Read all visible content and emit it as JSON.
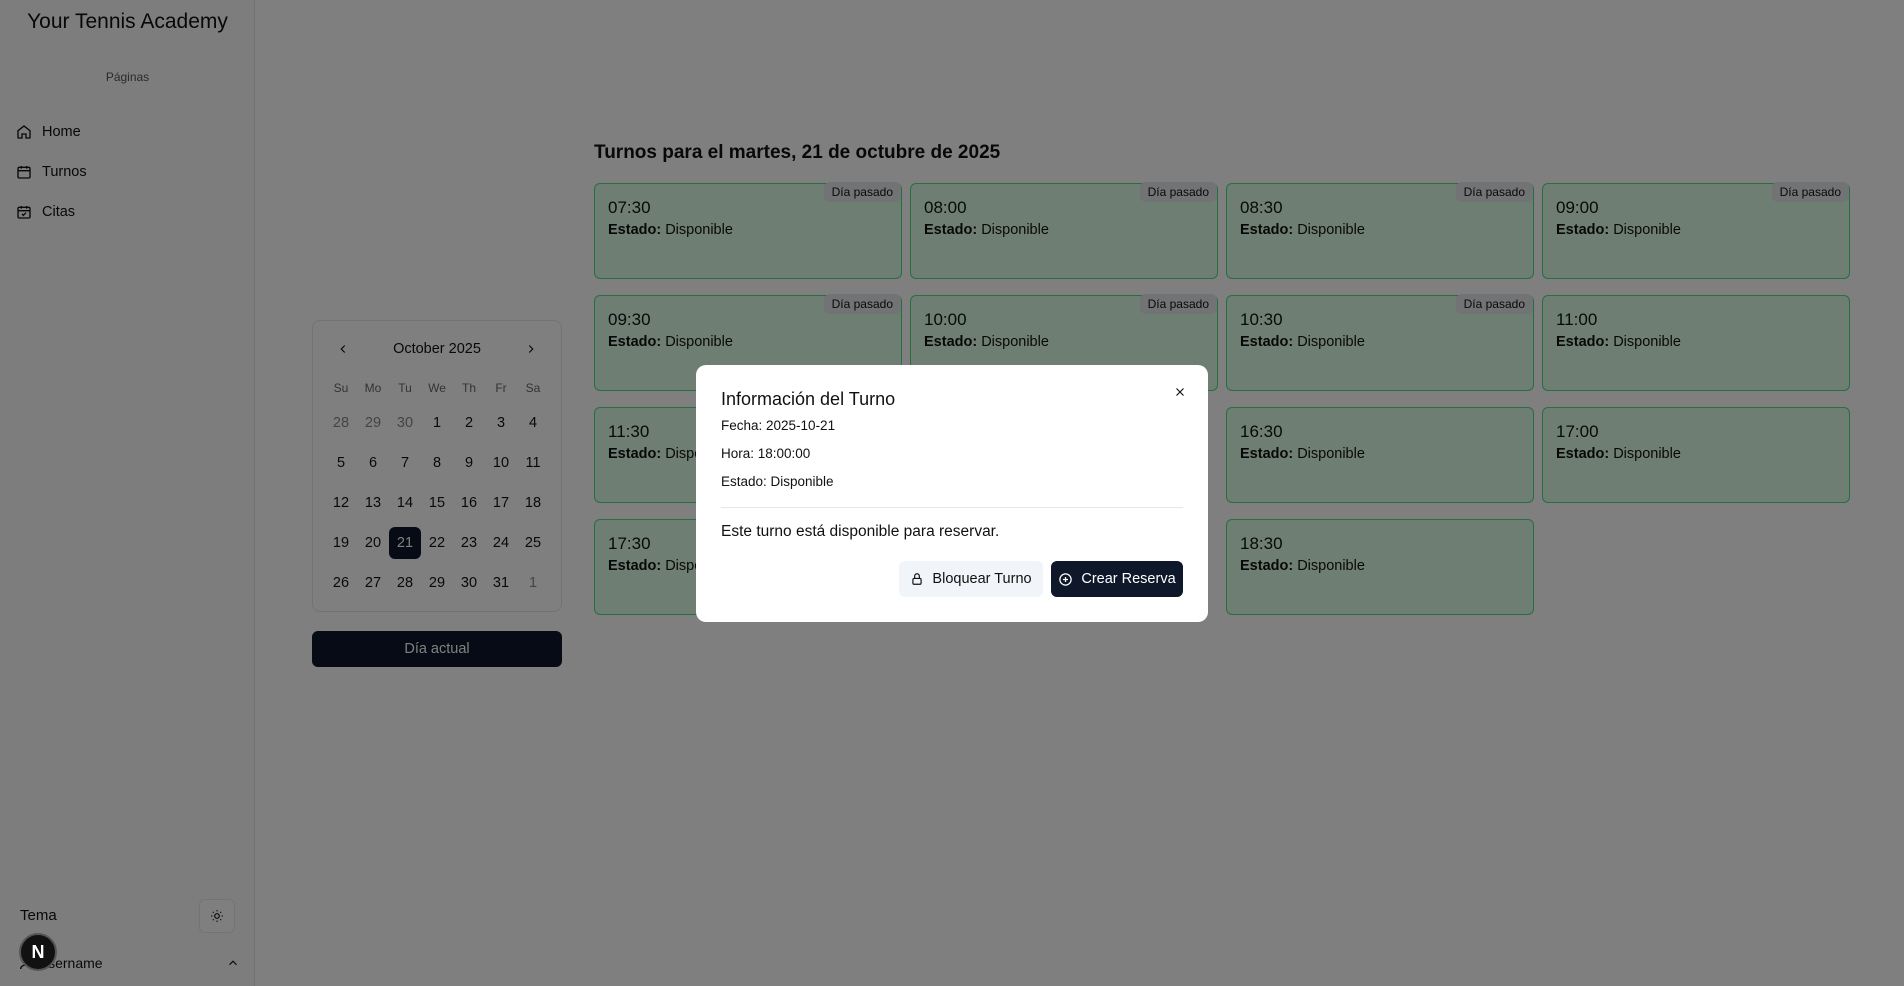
{
  "sidebar": {
    "brand": "Your Tennis Academy",
    "section_label": "Páginas",
    "items": [
      {
        "label": "Home",
        "icon": "home-icon"
      },
      {
        "label": "Turnos",
        "icon": "calendar-icon"
      },
      {
        "label": "Citas",
        "icon": "calendar-check-icon"
      }
    ],
    "theme_label": "Tema",
    "theme_icon": "sun-icon",
    "user_label": "Username",
    "avatar_letter": "N"
  },
  "calendar": {
    "month_title": "October 2025",
    "weekdays": [
      "Su",
      "Mo",
      "Tu",
      "We",
      "Th",
      "Fr",
      "Sa"
    ],
    "weeks": [
      [
        {
          "d": "28",
          "out": true
        },
        {
          "d": "29",
          "out": true
        },
        {
          "d": "30",
          "out": true
        },
        {
          "d": "1"
        },
        {
          "d": "2"
        },
        {
          "d": "3"
        },
        {
          "d": "4"
        }
      ],
      [
        {
          "d": "5"
        },
        {
          "d": "6"
        },
        {
          "d": "7"
        },
        {
          "d": "8"
        },
        {
          "d": "9"
        },
        {
          "d": "10"
        },
        {
          "d": "11"
        }
      ],
      [
        {
          "d": "12"
        },
        {
          "d": "13"
        },
        {
          "d": "14"
        },
        {
          "d": "15"
        },
        {
          "d": "16"
        },
        {
          "d": "17"
        },
        {
          "d": "18"
        }
      ],
      [
        {
          "d": "19"
        },
        {
          "d": "20"
        },
        {
          "d": "21",
          "sel": true
        },
        {
          "d": "22"
        },
        {
          "d": "23"
        },
        {
          "d": "24"
        },
        {
          "d": "25"
        }
      ],
      [
        {
          "d": "26"
        },
        {
          "d": "27"
        },
        {
          "d": "28"
        },
        {
          "d": "29"
        },
        {
          "d": "30"
        },
        {
          "d": "31"
        },
        {
          "d": "1",
          "out": true
        }
      ]
    ],
    "today_button": "Día actual"
  },
  "slots": {
    "title": "Turnos para el martes, 21 de octubre de 2025",
    "status_label": "Estado:",
    "items": [
      {
        "time": "07:30",
        "status": "Disponible",
        "badge": "Día pasado"
      },
      {
        "time": "08:00",
        "status": "Disponible",
        "badge": "Día pasado"
      },
      {
        "time": "08:30",
        "status": "Disponible",
        "badge": "Día pasado"
      },
      {
        "time": "09:00",
        "status": "Disponible",
        "badge": "Día pasado"
      },
      {
        "time": "09:30",
        "status": "Disponible",
        "badge": "Día pasado"
      },
      {
        "time": "10:00",
        "status": "Disponible",
        "badge": "Día pasado"
      },
      {
        "time": "10:30",
        "status": "Disponible",
        "badge": "Día pasado"
      },
      {
        "time": "11:00",
        "status": "Disponible",
        "badge": ""
      },
      {
        "time": "11:30",
        "status": "Disponible",
        "badge": ""
      },
      {
        "time": "",
        "status": "",
        "badge": ""
      },
      {
        "time": "16:30",
        "status": "Disponible",
        "badge": ""
      },
      {
        "time": "17:00",
        "status": "Disponible",
        "badge": ""
      },
      {
        "time": "17:30",
        "status": "Disponible",
        "badge": ""
      },
      {
        "time": "",
        "status": "",
        "badge": ""
      },
      {
        "time": "18:30",
        "status": "Disponible",
        "badge": ""
      }
    ]
  },
  "modal": {
    "title": "Información del Turno",
    "fecha": "Fecha: 2025-10-21",
    "hora": "Hora: 18:00:00",
    "estado": "Estado: Disponible",
    "message": "Este turno está disponible para reservar.",
    "block_button": "Bloquear Turno",
    "create_button": "Crear Reserva"
  }
}
